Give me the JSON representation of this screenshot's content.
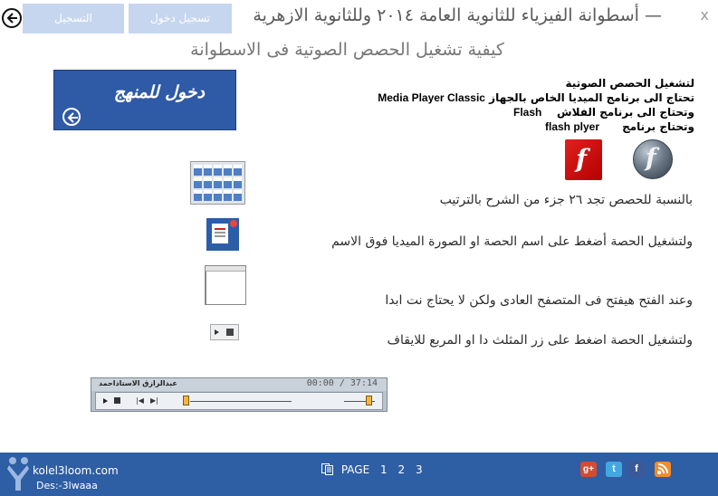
{
  "window": {
    "title": "أسطوانة الفيزياء للثانوية العامة ٢٠١٤ وللثانوية الازهرية",
    "title_dash": "—",
    "close": "x"
  },
  "topbar": {
    "back_icon": "back-arrow-icon",
    "register_label": "التسجيل",
    "login_label": "تسجيل دخول"
  },
  "page": {
    "section_title": "كيفية تشغيل الحصص الصوتية فى الاسطوانة",
    "enter_button": "دخول للمنهج",
    "enter_icon": "back-arrow-icon"
  },
  "requirements": {
    "heading": "لتشغيل الحصص الصوتية",
    "line1_text": "تحتاج الى برنامج الميديا الخاص بالجهاز",
    "line1_app": "Media Player Classic",
    "line2_text": "وتحتاج الى برنامج الفلاش",
    "line2_app": "Flash",
    "line3_text": "وتحتاج برنامج",
    "line3_app": "flash plyer"
  },
  "logos": {
    "flash_letter": "f",
    "flash_player_letter": "f"
  },
  "instructions": {
    "parts": "بالنسبة للحصص تجد ٢٦ جزء من الشرح بالترتيب",
    "click": "ولتشغيل الحصة أضغط على اسم الحصة او الصورة الميديا فوق الاسم",
    "browser": "وعند الفتح هيفتح فى المتصفح العادى ولكن لا يحتاج نت ابدا",
    "controls": "ولتشغيل الحصة اضغط على زر المثلث دا او المربع للايقاف"
  },
  "player": {
    "author": "عبدالرازق الاستاذاحمد",
    "time": "00:00 / 37:14",
    "progress": 0,
    "volume": 0.9
  },
  "footer": {
    "site": "kolel3loom.com",
    "designer": "Des:-3lwaaa",
    "page_label": "PAGE",
    "pages": [
      "1",
      "2",
      "3"
    ],
    "social": {
      "google": "g+",
      "twitter": "t",
      "facebook": "f",
      "rss": "rss"
    }
  },
  "colors": {
    "accent": "#2e5ea4",
    "button_disabled": "#c7d6ef",
    "flash_red": "#c40000"
  }
}
